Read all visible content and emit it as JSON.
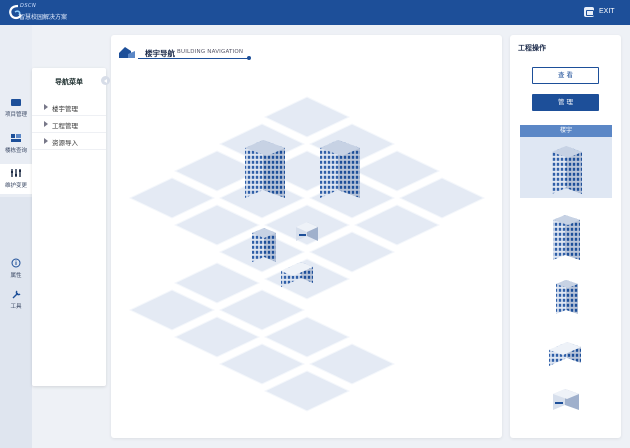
{
  "header": {
    "logo_line1": "DSCN",
    "logo_line2": "智慧校园解决方案",
    "exit_label": "EXIT",
    "exit_icon": "exit-icon"
  },
  "rail": {
    "items": [
      {
        "label": "项目管理",
        "icon": "folder-icon"
      },
      {
        "label": "楼栋查询",
        "icon": "building-search-icon"
      },
      {
        "label": "维护变更",
        "icon": "maintenance-icon"
      },
      {
        "label": "属性",
        "icon": "info-icon"
      },
      {
        "label": "工具",
        "icon": "wrench-icon"
      }
    ]
  },
  "nav": {
    "title": "导航菜单",
    "items": [
      {
        "label": "楼宇管理"
      },
      {
        "label": "工程管理"
      },
      {
        "label": "资源导入"
      }
    ]
  },
  "main": {
    "title": "楼宇导航",
    "subtitle": "BUILDING NAVIGATION"
  },
  "right": {
    "title": "工程操作",
    "view_button": "查 看",
    "manage_button": "管 理",
    "selected_card": "楼宇"
  },
  "colors": {
    "brand": "#1d4f99",
    "accent": "#5b87c6",
    "tile": "#e4eaf4"
  }
}
